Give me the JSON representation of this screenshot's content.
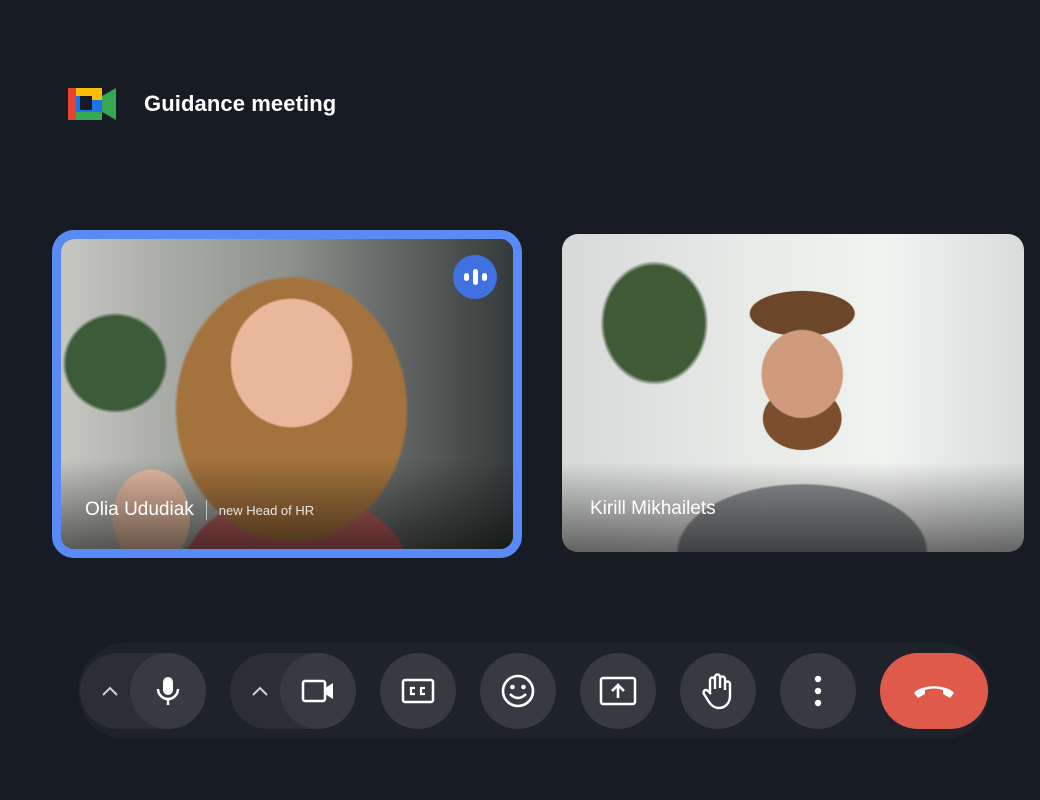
{
  "meeting": {
    "title": "Guidance meeting"
  },
  "participants": [
    {
      "name": "Olia Ududiak",
      "role": "new Head of HR"
    },
    {
      "name": "Kirill Mikhailets"
    }
  ],
  "icons": {
    "logo": "google-meet-logo",
    "speaking": "audio-indicator-icon",
    "mic": "microphone-icon",
    "camera": "camera-icon",
    "captions": "closed-captions-icon",
    "emoji": "emoji-icon",
    "present": "present-screen-icon",
    "hand": "raise-hand-icon",
    "more": "more-vertical-icon",
    "end": "end-call-icon"
  },
  "colors": {
    "background": "#171b24",
    "active_border": "#5a8af5",
    "end_call": "#e05a4c"
  }
}
